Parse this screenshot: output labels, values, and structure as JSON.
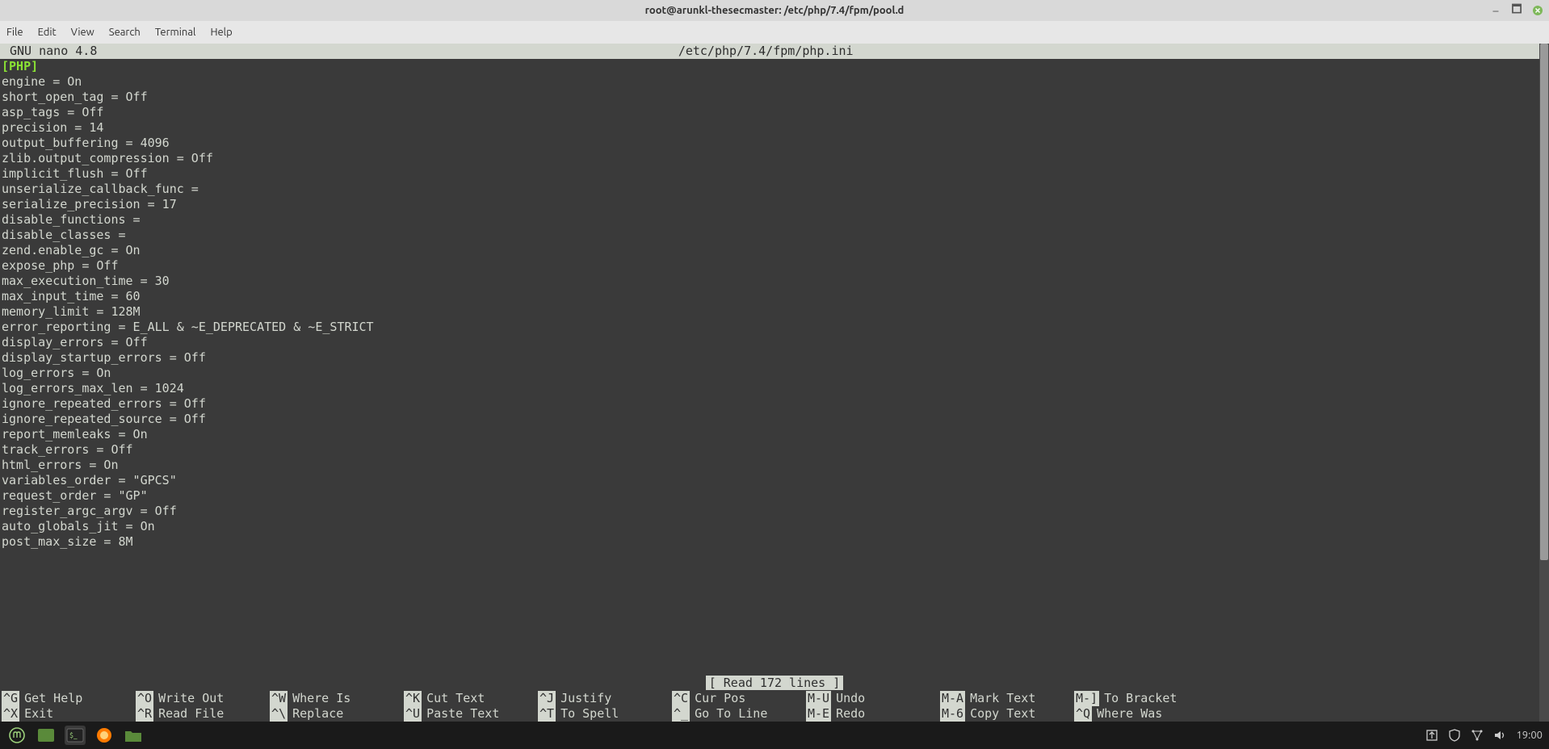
{
  "window": {
    "title": "root@arunkl-thesecmaster: /etc/php/7.4/fpm/pool.d"
  },
  "menubar": {
    "items": [
      "File",
      "Edit",
      "View",
      "Search",
      "Terminal",
      "Help"
    ]
  },
  "nano": {
    "app": "  GNU nano 4.8",
    "file": "/etc/php/7.4/fpm/php.ini",
    "section_header": "[PHP]",
    "content_lines": [
      "engine = On",
      "short_open_tag = Off",
      "asp_tags = Off",
      "precision = 14",
      "output_buffering = 4096",
      "zlib.output_compression = Off",
      "implicit_flush = Off",
      "unserialize_callback_func =",
      "serialize_precision = 17",
      "disable_functions =",
      "disable_classes =",
      "zend.enable_gc = On",
      "expose_php = Off",
      "max_execution_time = 30",
      "max_input_time = 60",
      "memory_limit = 128M",
      "error_reporting = E_ALL & ~E_DEPRECATED & ~E_STRICT",
      "display_errors = Off",
      "display_startup_errors = Off",
      "log_errors = On",
      "log_errors_max_len = 1024",
      "ignore_repeated_errors = Off",
      "ignore_repeated_source = Off",
      "report_memleaks = On",
      "track_errors = Off",
      "html_errors = On",
      "variables_order = \"GPCS\"",
      "request_order = \"GP\"",
      "register_argc_argv = Off",
      "auto_globals_jit = On",
      "post_max_size = 8M"
    ],
    "status": "[ Read 172 lines ]",
    "help": [
      [
        {
          "key": "^G",
          "label": "Get Help"
        },
        {
          "key": "^O",
          "label": "Write Out"
        },
        {
          "key": "^W",
          "label": "Where Is"
        },
        {
          "key": "^K",
          "label": "Cut Text"
        },
        {
          "key": "^J",
          "label": "Justify"
        },
        {
          "key": "^C",
          "label": "Cur Pos"
        },
        {
          "key": "M-U",
          "label": "Undo"
        },
        {
          "key": "M-A",
          "label": "Mark Text"
        },
        {
          "key": "M-]",
          "label": "To Bracket"
        }
      ],
      [
        {
          "key": "^X",
          "label": "Exit"
        },
        {
          "key": "^R",
          "label": "Read File"
        },
        {
          "key": "^\\",
          "label": "Replace"
        },
        {
          "key": "^U",
          "label": "Paste Text"
        },
        {
          "key": "^T",
          "label": "To Spell"
        },
        {
          "key": "^_",
          "label": "Go To Line"
        },
        {
          "key": "M-E",
          "label": "Redo"
        },
        {
          "key": "M-6",
          "label": "Copy Text"
        },
        {
          "key": "^Q",
          "label": "Where Was"
        }
      ]
    ]
  },
  "panel": {
    "clock": "19:00"
  }
}
